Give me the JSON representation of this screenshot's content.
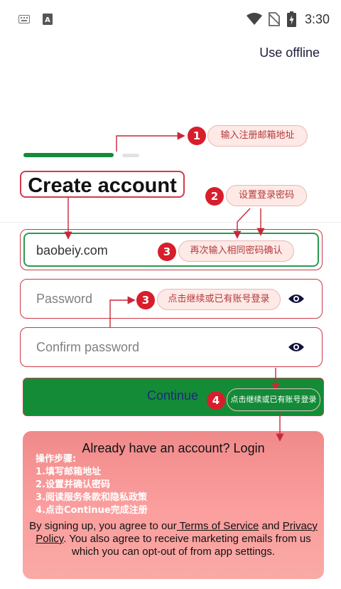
{
  "status_bar": {
    "time": "3:30",
    "icons": [
      "keyboard-icon",
      "a-box-icon",
      "wifi-icon",
      "no-sim-icon",
      "battery-icon"
    ]
  },
  "header": {
    "use_offline": "Use offline"
  },
  "progress": {
    "step": 1,
    "total": 2
  },
  "page": {
    "title": "Create account"
  },
  "form": {
    "email_value": "baobeiy.com",
    "password_placeholder": "Password",
    "confirm_placeholder": "Confirm password",
    "continue_label": "Continue"
  },
  "footer": {
    "login_text": "Already have an account? Login",
    "terms_before": "By signing up, you agree to our",
    "terms_link": " Terms of Service",
    "terms_and": " and",
    "privacy_link": "Privacy Policy",
    "terms_after": ". You also agree to receive marketing emails from us which you can opt-out of from app settings."
  },
  "annotations": {
    "a1": {
      "num": "1",
      "text": "输入注册邮箱地址"
    },
    "a2": {
      "num": "2",
      "text": "设置登录密码"
    },
    "a3a": {
      "num": "3",
      "text": "再次输入相同密码确认"
    },
    "a3b": {
      "num": "3",
      "text": "点击继续或已有账号登录"
    },
    "a4": {
      "num": "4",
      "text": "点击继续或已有账号登录"
    },
    "steps_title": "操作步骤:",
    "steps": [
      "1.填写邮箱地址",
      "2.设置并确认密码",
      "3.阅读服务条款和隐私政策",
      "4.点击Continue完成注册"
    ]
  },
  "colors": {
    "accent_green": "#148c37",
    "annotation_red": "#d81e2b",
    "panel_pink": "#f99c9c"
  }
}
